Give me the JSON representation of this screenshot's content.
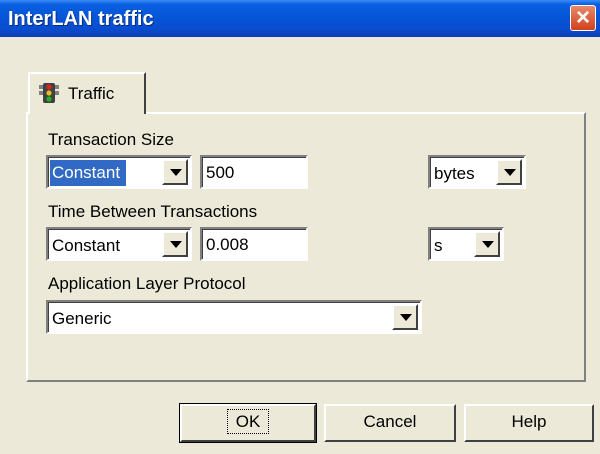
{
  "window": {
    "title": "InterLAN traffic"
  },
  "tabs": [
    {
      "label": "Traffic",
      "icon": "traffic-light-icon"
    }
  ],
  "transaction_size": {
    "label": "Transaction Size",
    "distribution": "Constant",
    "value": "500",
    "unit": "bytes"
  },
  "time_between": {
    "label": "Time Between Transactions",
    "distribution": "Constant",
    "value": "0.008",
    "unit": "s"
  },
  "protocol": {
    "label": "Application Layer Protocol",
    "value": "Generic"
  },
  "buttons": {
    "ok": "OK",
    "cancel": "Cancel",
    "help": "Help"
  },
  "colors": {
    "titlebar": "#0556d8",
    "selection": "#316ac5",
    "close": "#d2411c",
    "face": "#ece9d8"
  }
}
